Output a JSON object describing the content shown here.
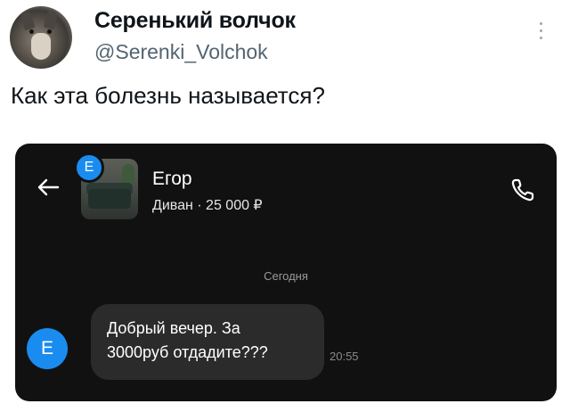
{
  "tweet": {
    "display_name": "Серенький волчок",
    "handle": "@Serenki_Volchok",
    "text": "Как эта болезнь называется?",
    "more_icon": "more-vertical-icon"
  },
  "chat": {
    "seller_initial": "Е",
    "contact_name": "Егор",
    "listing": "Диван · 25 000 ₽",
    "date_separator": "Сегодня",
    "icons": {
      "back": "arrow-left-icon",
      "call": "phone-icon"
    },
    "colors": {
      "background": "#111111",
      "bubble": "#2b2b2b",
      "accent": "#1a8cf0"
    },
    "message": {
      "avatar_initial": "Е",
      "lines": [
        "Добрый вечер. За",
        "3000руб отдадите???"
      ],
      "time": "20:55"
    }
  }
}
